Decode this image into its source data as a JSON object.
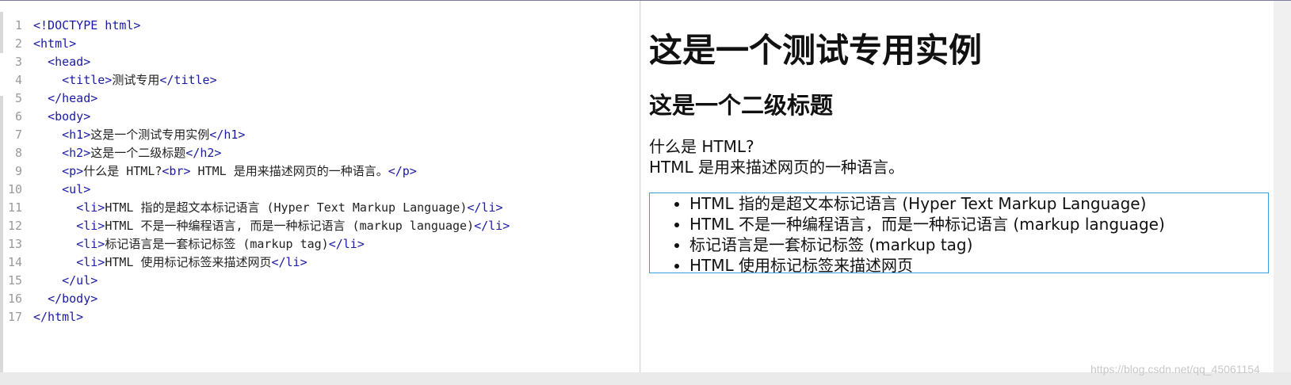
{
  "editor": {
    "lines": [
      {
        "n": "1",
        "parts": [
          {
            "t": "tag",
            "v": "<!DOCTYPE html>"
          }
        ]
      },
      {
        "n": "2",
        "parts": [
          {
            "t": "tag",
            "v": "<html>"
          }
        ]
      },
      {
        "n": "3",
        "parts": [
          {
            "t": "txt",
            "v": "  "
          },
          {
            "t": "tag",
            "v": "<head>"
          }
        ]
      },
      {
        "n": "4",
        "parts": [
          {
            "t": "txt",
            "v": "    "
          },
          {
            "t": "tag",
            "v": "<title>"
          },
          {
            "t": "txt",
            "v": "测试专用"
          },
          {
            "t": "tag",
            "v": "</title>"
          }
        ]
      },
      {
        "n": "5",
        "parts": [
          {
            "t": "txt",
            "v": "  "
          },
          {
            "t": "tag",
            "v": "</head>"
          }
        ]
      },
      {
        "n": "6",
        "parts": [
          {
            "t": "txt",
            "v": "  "
          },
          {
            "t": "tag",
            "v": "<body>"
          }
        ]
      },
      {
        "n": "7",
        "parts": [
          {
            "t": "txt",
            "v": "    "
          },
          {
            "t": "tag",
            "v": "<h1>"
          },
          {
            "t": "txt",
            "v": "这是一个测试专用实例"
          },
          {
            "t": "tag",
            "v": "</h1>"
          }
        ]
      },
      {
        "n": "8",
        "parts": [
          {
            "t": "txt",
            "v": "    "
          },
          {
            "t": "tag",
            "v": "<h2>"
          },
          {
            "t": "txt",
            "v": "这是一个二级标题"
          },
          {
            "t": "tag",
            "v": "</h2>"
          }
        ]
      },
      {
        "n": "9",
        "parts": [
          {
            "t": "txt",
            "v": "    "
          },
          {
            "t": "tag",
            "v": "<p>"
          },
          {
            "t": "txt",
            "v": "什么是 HTML?"
          },
          {
            "t": "tag",
            "v": "<br>"
          },
          {
            "t": "txt",
            "v": " HTML 是用来描述网页的一种语言。"
          },
          {
            "t": "tag",
            "v": "</p>"
          }
        ]
      },
      {
        "n": "10",
        "parts": [
          {
            "t": "txt",
            "v": "    "
          },
          {
            "t": "tag",
            "v": "<ul>"
          }
        ]
      },
      {
        "n": "11",
        "parts": [
          {
            "t": "txt",
            "v": "      "
          },
          {
            "t": "tag",
            "v": "<li>"
          },
          {
            "t": "txt",
            "v": "HTML 指的是超文本标记语言 (Hyper Text Markup Language)"
          },
          {
            "t": "tag",
            "v": "</li>"
          }
        ]
      },
      {
        "n": "12",
        "parts": [
          {
            "t": "txt",
            "v": "      "
          },
          {
            "t": "tag",
            "v": "<li>"
          },
          {
            "t": "txt",
            "v": "HTML 不是一种编程语言, 而是一种标记语言 (markup language)"
          },
          {
            "t": "tag",
            "v": "</li>"
          }
        ]
      },
      {
        "n": "13",
        "parts": [
          {
            "t": "txt",
            "v": "      "
          },
          {
            "t": "tag",
            "v": "<li>"
          },
          {
            "t": "txt",
            "v": "标记语言是一套标记标签 (markup tag)"
          },
          {
            "t": "tag",
            "v": "</li>"
          }
        ]
      },
      {
        "n": "14",
        "parts": [
          {
            "t": "txt",
            "v": "      "
          },
          {
            "t": "tag",
            "v": "<li>"
          },
          {
            "t": "txt",
            "v": "HTML 使用标记标签来描述网页"
          },
          {
            "t": "tag",
            "v": "</li>"
          }
        ]
      },
      {
        "n": "15",
        "parts": [
          {
            "t": "txt",
            "v": "    "
          },
          {
            "t": "tag",
            "v": "</ul>"
          }
        ]
      },
      {
        "n": "16",
        "parts": [
          {
            "t": "txt",
            "v": "  "
          },
          {
            "t": "tag",
            "v": "</body>"
          }
        ]
      },
      {
        "n": "17",
        "parts": [
          {
            "t": "tag",
            "v": "</html>"
          }
        ]
      }
    ]
  },
  "preview": {
    "h1": "这是一个测试专用实例",
    "h2": "这是一个二级标题",
    "p_line1": "什么是 HTML?",
    "p_line2": "HTML 是用来描述网页的一种语言。",
    "list": [
      "HTML 指的是超文本标记语言 (Hyper Text Markup Language)",
      "HTML 不是一种编程语言，而是一种标记语言 (markup language)",
      "标记语言是一套标记标签 (markup tag)",
      "HTML 使用标记标签来描述网页"
    ]
  },
  "watermark": "https://blog.csdn.net/qq_45061154",
  "colors": {
    "tag": "#1a1aa6",
    "text": "#222222",
    "list_border": "#39a0dc"
  }
}
